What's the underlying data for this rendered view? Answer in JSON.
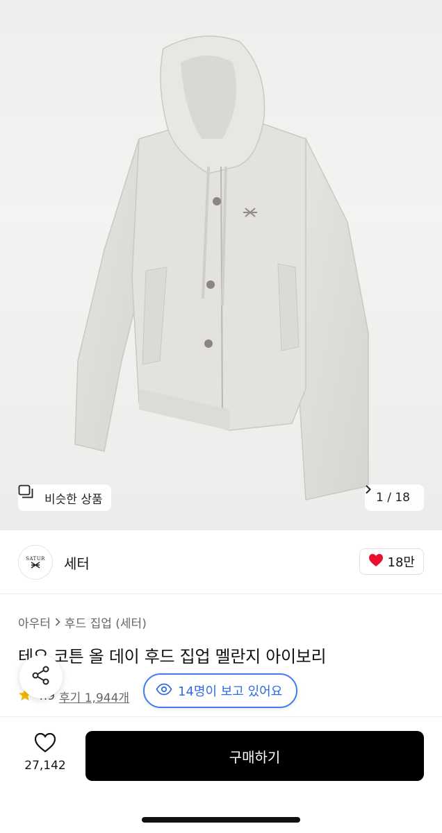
{
  "image": {
    "similar_label": "비슷한 상품",
    "page_counter": "1 / 18"
  },
  "brand": {
    "logo_text": "SATUR",
    "name": "세터",
    "like_count": "18만"
  },
  "product": {
    "breadcrumb": [
      "아우터",
      "후드 집업 (세터)"
    ],
    "title": "테오 코튼 올 데이 후드 집업 멜란지 아이보리",
    "rating": "4.9",
    "reviews": "후기 1,944개",
    "viewers": "14명이 보고 있어요"
  },
  "bottom": {
    "wish_count": "27,142",
    "buy_label": "구매하기"
  },
  "colors": {
    "accent_blue": "#2f6be8",
    "heart_red": "#e8102d",
    "star_yellow": "#f5b800"
  }
}
